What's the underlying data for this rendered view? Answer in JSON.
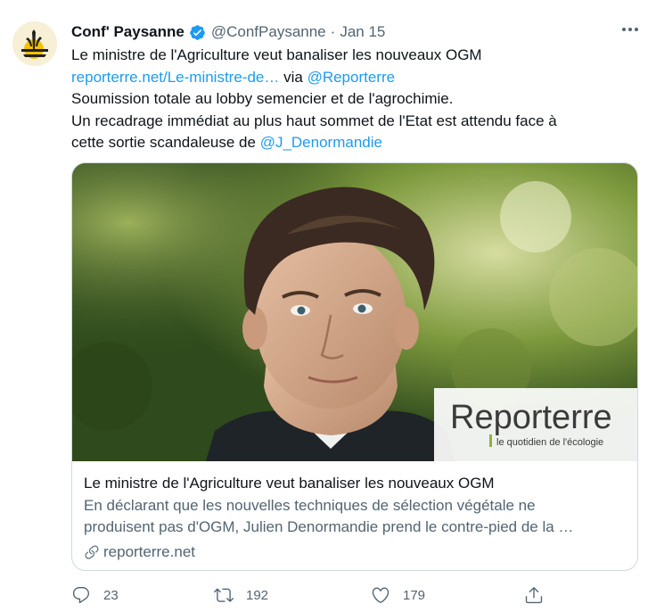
{
  "tweet": {
    "name": "Conf' Paysanne",
    "handle": "@ConfPaysanne",
    "separator": "·",
    "date": "Jan 15",
    "lines": {
      "l1": "Le ministre de l'Agriculture veut banaliser les nouveaux OGM",
      "l2_link": "reporterre.net/Le-ministre-de…",
      "l2_via": " via ",
      "l2_mention": "@Reporterre",
      "l3": "Soumission totale au lobby semencier et de l'agrochimie.",
      "l4": "Un recadrage immédiat au plus haut sommet de l'Etat est attendu face à",
      "l5": "cette sortie scandaleuse de ",
      "l5_mention": "@J_Denormandie"
    },
    "card": {
      "logo_text": "Reporterre",
      "logo_tagline": "le quotidien de l'écologie",
      "title": "Le ministre de l'Agriculture veut banaliser les nouveaux OGM",
      "desc_line1": "En déclarant que les nouvelles techniques de sélection végétale ne",
      "desc_line2": "produisent pas d'OGM, Julien Denormandie prend le contre-pied de la …",
      "domain": "reporterre.net"
    },
    "actions": {
      "replies": "23",
      "retweets": "192",
      "likes": "179"
    }
  },
  "colors": {
    "accent": "#1d9bf0",
    "muted": "#536471",
    "text": "#0f1419",
    "border": "#cfd9de"
  },
  "icons": {
    "verified": "verified-badge-icon",
    "more": "more-dots-icon",
    "reply": "reply-icon",
    "retweet": "retweet-icon",
    "like": "heart-icon",
    "share": "share-icon",
    "link": "link-icon"
  }
}
